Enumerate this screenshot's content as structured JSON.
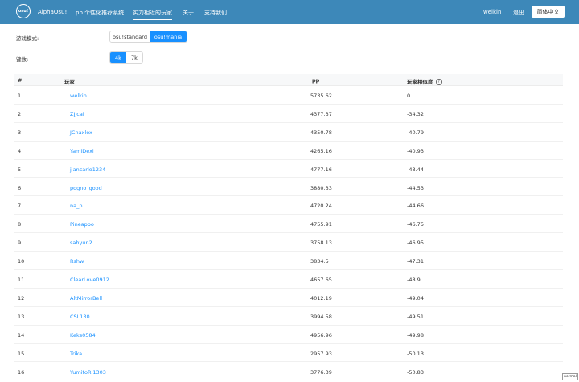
{
  "header": {
    "logo_text": "osu!",
    "brand": "AlphaOsu!",
    "nav": [
      {
        "label": "pp 个性化推荐系统",
        "active": false
      },
      {
        "label": "实力相近的玩家",
        "active": true
      },
      {
        "label": "关于",
        "active": false
      },
      {
        "label": "支持我们",
        "active": false
      }
    ],
    "username": "welkin",
    "logout": "退出",
    "language": "简体中文"
  },
  "filters": {
    "mode_label": "游戏模式:",
    "modes": [
      {
        "label": "osu!standard",
        "selected": false
      },
      {
        "label": "osu!mania",
        "selected": true
      }
    ],
    "keys_label": "键数:",
    "keys": [
      {
        "label": "4k",
        "selected": true
      },
      {
        "label": "7k",
        "selected": false
      }
    ]
  },
  "table": {
    "columns": [
      "#",
      "玩家",
      "pp",
      "玩家相似度"
    ],
    "rows": [
      {
        "rank": "1",
        "player": "welkin",
        "pp": "5735.62",
        "similarity": "0"
      },
      {
        "rank": "2",
        "player": "ZJJcai",
        "pp": "4377.37",
        "similarity": "-34.32"
      },
      {
        "rank": "3",
        "player": "JCnaxlox",
        "pp": "4350.78",
        "similarity": "-40.79"
      },
      {
        "rank": "4",
        "player": "YamiDexi",
        "pp": "4265.16",
        "similarity": "-40.93"
      },
      {
        "rank": "5",
        "player": "jiancarlo1234",
        "pp": "4777.16",
        "similarity": "-43.44"
      },
      {
        "rank": "6",
        "player": "pogno_good",
        "pp": "3880.33",
        "similarity": "-44.53"
      },
      {
        "rank": "7",
        "player": "na_p",
        "pp": "4720.24",
        "similarity": "-44.66"
      },
      {
        "rank": "8",
        "player": "Pineappo",
        "pp": "4755.91",
        "similarity": "-46.75"
      },
      {
        "rank": "9",
        "player": "sahyun2",
        "pp": "3758.13",
        "similarity": "-46.95"
      },
      {
        "rank": "10",
        "player": "Rshw",
        "pp": "3834.5",
        "similarity": "-47.31"
      },
      {
        "rank": "11",
        "player": "ClearLove0912",
        "pp": "4657.65",
        "similarity": "-48.9"
      },
      {
        "rank": "12",
        "player": "AltMirrorBell",
        "pp": "4012.19",
        "similarity": "-49.04"
      },
      {
        "rank": "13",
        "player": "CSL130",
        "pp": "3994.58",
        "similarity": "-49.51"
      },
      {
        "rank": "14",
        "player": "Keks0584",
        "pp": "4956.96",
        "similarity": "-49.98"
      },
      {
        "rank": "15",
        "player": "Trika",
        "pp": "2957.93",
        "similarity": "-50.13"
      },
      {
        "rank": "16",
        "player": "YumitoRi1303",
        "pp": "3776.39",
        "similarity": "-50.83"
      }
    ]
  },
  "badge": "normal"
}
